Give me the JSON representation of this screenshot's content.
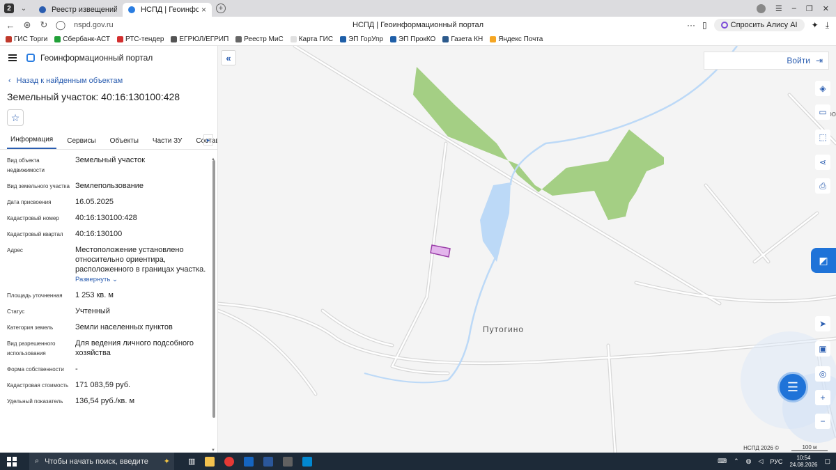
{
  "browser": {
    "tab_counter": "2",
    "tabs": [
      {
        "title": "Реестр извещений",
        "active": false
      },
      {
        "title": "НСПД | Геоинформационн",
        "active": true
      }
    ],
    "url": "nspd.gov.ru",
    "page_title": "НСПД | Геоинформационный портал",
    "alice_label": "Спросить Алису AI",
    "bookmarks": [
      "ГИС Торги",
      "Сбербанк-АСТ",
      "РТС-тендер",
      "ЕГРЮЛ/ЕГРИП",
      "Реестр МиС",
      "Карта ГИС",
      "ЭП ГорУпр",
      "ЭП ПрокКО",
      "Газета КН",
      "Яндекс Почта"
    ]
  },
  "portal": {
    "name": "Геоинформационный портал",
    "back_label": "Назад к найденным объектам",
    "object_title": "Земельный участок: 40:16:130100:428",
    "tabs": [
      "Информация",
      "Сервисы",
      "Объекты",
      "Части ЗУ",
      "Состав"
    ],
    "active_tab": "Информация",
    "properties": [
      {
        "label": "Вид объекта недвижимости",
        "value": "Земельный участок"
      },
      {
        "label": "Вид земельного участка",
        "value": "Землепользование"
      },
      {
        "label": "Дата присвоения",
        "value": "16.05.2025"
      },
      {
        "label": "Кадастровый номер",
        "value": "40:16:130100:428"
      },
      {
        "label": "Кадастровый квартал",
        "value": "40:16:130100"
      },
      {
        "label": "Адрес",
        "value": "Местоположение установлено относительно ориентира, расположенного в границах участка.",
        "expand": "Развернуть"
      },
      {
        "label": "Площадь уточненная",
        "value": "1 253 кв. м"
      },
      {
        "label": "Статус",
        "value": "Учтенный"
      },
      {
        "label": "Категория земель",
        "value": "Земли населенных пунктов"
      },
      {
        "label": "Вид разрешенного использования",
        "value": "Для ведения личного подсобного хозяйства"
      },
      {
        "label": "Форма собственности",
        "value": "-"
      },
      {
        "label": "Кадастровая стоимость",
        "value": "171 083,59 руб."
      },
      {
        "label": "Удельный показатель",
        "value": "136,54 руб./кв. м"
      }
    ]
  },
  "map": {
    "login_label": "Войти",
    "place_label": "Путогино",
    "edge_text": "ро",
    "copyright": "НСПД 2026 ©",
    "scale": "100 м",
    "colors": {
      "forest": "#a4cf84",
      "water": "#bcd9f7",
      "parcel": "#e3b5ec",
      "parcel_border": "#9a3ea8",
      "roads": "#dcdcdc"
    }
  },
  "taskbar": {
    "search_placeholder": "Чтобы начать поиск, введите",
    "lang": "РУС",
    "time": "10:54",
    "date": "24.08.2026"
  }
}
